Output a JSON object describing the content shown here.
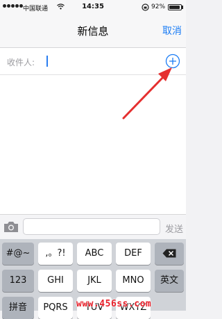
{
  "status_bar": {
    "carrier": "中国联通",
    "time": "14:35",
    "battery": "92%",
    "battery_level": 0.92
  },
  "nav": {
    "title": "新信息",
    "cancel_label": "取消"
  },
  "recipient": {
    "label": "收件人:",
    "value": ""
  },
  "compose": {
    "placeholder": "",
    "send_label": "发送"
  },
  "keyboard": {
    "row1": [
      "#@~",
      ",。?!",
      "ABC",
      "DEF",
      "delete-icon"
    ],
    "row2": [
      "123",
      "GHI",
      "JKL",
      "MNO",
      "英文"
    ],
    "row3": [
      "拼音",
      "PQRS",
      "TUV",
      "WXYZ"
    ]
  },
  "watermark": "www.456ss.com",
  "colors": {
    "accent": "#1a7cf5",
    "arrow": "#e53030",
    "watermark": "#e8202a"
  }
}
